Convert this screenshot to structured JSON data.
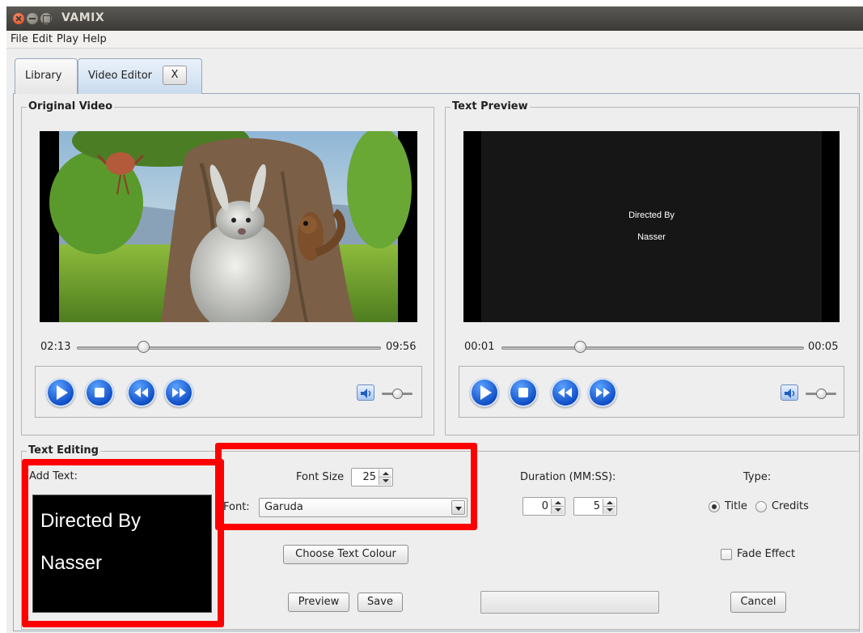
{
  "window": {
    "title": "VAMIX"
  },
  "menu": {
    "items": [
      "File",
      "Edit",
      "Play",
      "Help"
    ]
  },
  "tabs": {
    "library": "Library",
    "video_editor": "Video Editor",
    "close_label": "X"
  },
  "original_video": {
    "title": "Original Video",
    "current_time": "02:13",
    "total_time": "09:56",
    "seek_fraction": 0.22,
    "volume_fraction": 0.5
  },
  "text_preview": {
    "title": "Text Preview",
    "line1": "Directed By",
    "line2": "Nasser",
    "current_time": "00:01",
    "total_time": "00:05",
    "seek_fraction": 0.26,
    "volume_fraction": 0.5
  },
  "controls": {
    "icons": [
      "play-icon",
      "stop-icon",
      "rewind-icon",
      "fast-forward-icon",
      "volume-icon"
    ]
  },
  "text_editing": {
    "title": "Text Editing",
    "add_text_label": "Add Text:",
    "text_line1": "Directed By",
    "text_line2": "Nasser",
    "font_size_label": "Font Size",
    "font_size_value": "25",
    "font_label": "Font:",
    "font_value": "Garuda",
    "duration_label": "Duration (MM:SS):",
    "duration_minutes": "0",
    "duration_seconds": "5",
    "type_label": "Type:",
    "type_title": "Title",
    "type_credits": "Credits",
    "type_selected": "Title",
    "choose_colour_label": "Choose Text Colour",
    "fade_effect_label": "Fade Effect",
    "fade_effect_checked": false,
    "preview_label": "Preview",
    "save_label": "Save",
    "cancel_label": "Cancel"
  },
  "colors": {
    "highlight": "#ff0000",
    "accent": "#0b49c2"
  }
}
